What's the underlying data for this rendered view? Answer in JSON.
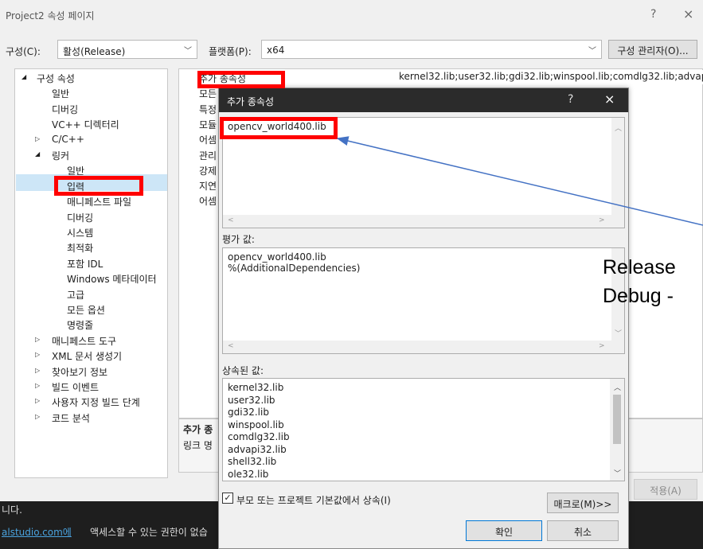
{
  "window": {
    "title": "Project2 속성 페이지",
    "help_icon": "?",
    "close_icon": "×"
  },
  "config_bar": {
    "config_label": "구성(C):",
    "config_value": "활성(Release)",
    "platform_label": "플랫폼(P):",
    "platform_value": "x64",
    "manager_button": "구성 관리자(O)..."
  },
  "tree": {
    "items": [
      {
        "label": "구성 속성",
        "expander": "◢"
      },
      {
        "label": "일반"
      },
      {
        "label": "디버깅"
      },
      {
        "label": "VC++ 디렉터리"
      },
      {
        "label": "C/C++",
        "expander": "▷"
      },
      {
        "label": "링커",
        "expander": "◢"
      },
      {
        "label": "일반"
      },
      {
        "label": "입력"
      },
      {
        "label": "매니페스트 파일"
      },
      {
        "label": "디버깅"
      },
      {
        "label": "시스템"
      },
      {
        "label": "최적화"
      },
      {
        "label": "포함 IDL"
      },
      {
        "label": "Windows 메타데이터"
      },
      {
        "label": "고급"
      },
      {
        "label": "모든 옵션"
      },
      {
        "label": "명령줄"
      },
      {
        "label": "매니페스트 도구",
        "expander": "▷"
      },
      {
        "label": "XML 문서 생성기",
        "expander": "▷"
      },
      {
        "label": "찾아보기 정보",
        "expander": "▷"
      },
      {
        "label": "빌드 이벤트",
        "expander": "▷"
      },
      {
        "label": "사용자 지정 빌드 단계",
        "expander": "▷"
      },
      {
        "label": "코드 분석",
        "expander": "▷"
      }
    ]
  },
  "grid": {
    "rows": [
      {
        "name": "추가 종속성"
      },
      {
        "name": "모든"
      },
      {
        "name": "특정"
      },
      {
        "name": "모듈"
      },
      {
        "name": "어셈"
      },
      {
        "name": "관리"
      },
      {
        "name": "강제"
      },
      {
        "name": "지연"
      },
      {
        "name": "어셈"
      }
    ],
    "first_value": "kernel32.lib;user32.lib;gdi32.lib;winspool.lib;comdlg32.lib;advapi32"
  },
  "description": {
    "title": "추가 종",
    "text": "링크 명"
  },
  "apply_button": "적용(A)",
  "status": {
    "line1": "니다.",
    "link": "alstudio.com에",
    "line2": "액세스할 수 있는 권한이 없습"
  },
  "dialog": {
    "title": "추가 종속성",
    "help_icon": "?",
    "close_icon": "×",
    "edit_value": "opencv_world400.lib",
    "eval_label": "평가 값:",
    "eval_lines": [
      "opencv_world400.lib",
      "%(AdditionalDependencies)"
    ],
    "inherited_label": "상속된 값:",
    "inherited_lines": [
      "kernel32.lib",
      "user32.lib",
      "gdi32.lib",
      "winspool.lib",
      "comdlg32.lib",
      "advapi32.lib",
      "shell32.lib",
      "ole32.lib"
    ],
    "inherit_checkbox": "부모 또는 프로젝트 기본값에서 상속(I)",
    "inherit_checked": true,
    "macro_button": "매크로(M)>>",
    "ok_button": "확인",
    "cancel_button": "취소"
  },
  "annotation": {
    "line1": "Release",
    "line2": "Debug -",
    "red": "#ff0000",
    "arrow": "#4472c4"
  }
}
